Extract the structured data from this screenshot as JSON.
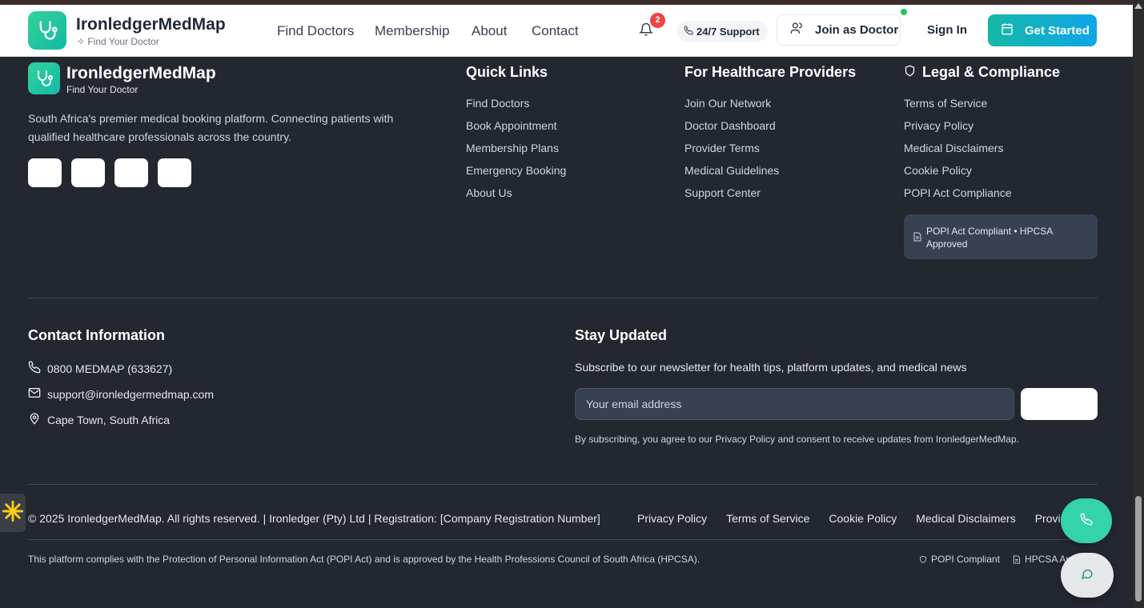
{
  "header": {
    "brand": "IronledgerMedMap",
    "tagline": "Find Your Doctor",
    "nav": [
      "Find Doctors",
      "Membership",
      "About",
      "Contact"
    ],
    "notifications_count": "2",
    "support_label": "24/7 Support",
    "join_label": "Join as Doctor",
    "signin_label": "Sign In",
    "get_started_label": "Get Started"
  },
  "footer": {
    "brand": "IronledgerMedMap",
    "tagline": "Find Your Doctor",
    "description": "South Africa's premier medical booking platform. Connecting patients with qualified healthcare professionals across the country.",
    "quick_links": {
      "title": "Quick Links",
      "items": [
        "Find Doctors",
        "Book Appointment",
        "Membership Plans",
        "Emergency Booking",
        "About Us"
      ]
    },
    "providers": {
      "title": "For Healthcare Providers",
      "items": [
        "Join Our Network",
        "Doctor Dashboard",
        "Provider Terms",
        "Medical Guidelines",
        "Support Center"
      ]
    },
    "legal": {
      "title": "Legal & Compliance",
      "items": [
        "Terms of Service",
        "Privacy Policy",
        "Medical Disclaimers",
        "Cookie Policy",
        "POPI Act Compliance"
      ],
      "compliance_badge": "POPI Act Compliant • HPCSA Approved"
    },
    "contact": {
      "title": "Contact Information",
      "phone": "0800 MEDMAP (633627)",
      "email": "support@ironledgermedmap.com",
      "location": "Cape Town, South Africa"
    },
    "newsletter": {
      "title": "Stay Updated",
      "subtitle": "Subscribe to our newsletter for health tips, platform updates, and medical news",
      "placeholder": "Your email address",
      "note": "By subscribing, you agree to our Privacy Policy and consent to receive updates from IronledgerMedMap."
    },
    "copyright": "© 2025 IronledgerMedMap. All rights reserved. | Ironledger (Pty) Ltd | Registration: [Company Registration Number]",
    "bottom_links": [
      "Privacy Policy",
      "Terms of Service",
      "Cookie Policy",
      "Medical Disclaimers",
      "Provider Terms"
    ],
    "legal_note": "This platform complies with the Protection of Personal Information Act (POPI Act) and is approved by the Health Professions Council of South Africa (HPCSA).",
    "badges": [
      "POPI Compliant",
      "HPCSA Approved"
    ]
  },
  "colors": {
    "footer_bg": "#23272f",
    "accent": "#14b8a6",
    "accent_secondary": "#0ea5e9",
    "badge_red": "#ef4444"
  }
}
